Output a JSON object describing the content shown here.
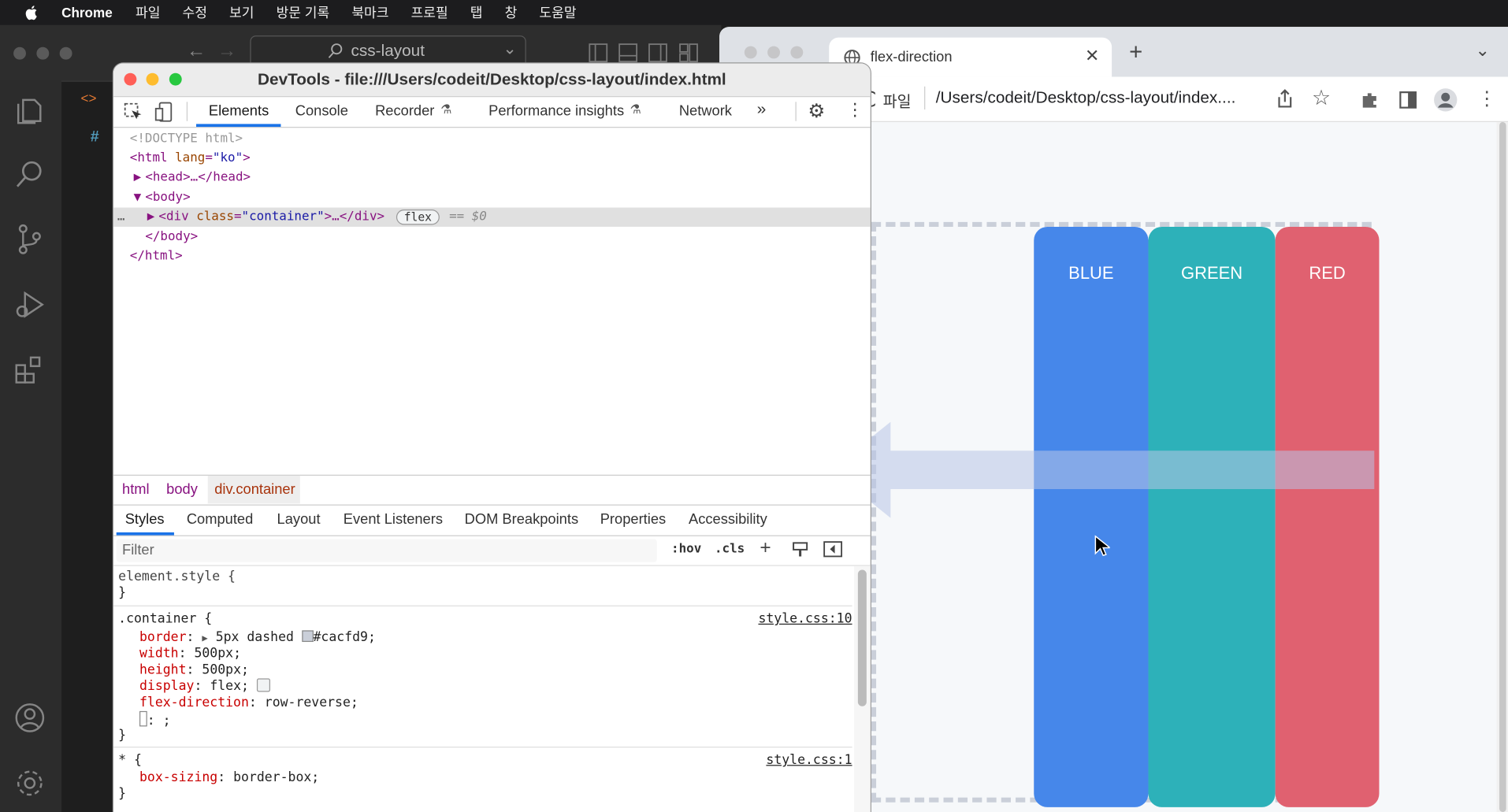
{
  "menubar": {
    "app": "Chrome",
    "items": [
      "파일",
      "수정",
      "보기",
      "방문 기록",
      "북마크",
      "프로필",
      "탭",
      "창",
      "도움말"
    ]
  },
  "vscode": {
    "search": "css-layout",
    "tab_hint": "<>",
    "editor_hash": "#"
  },
  "chrome": {
    "tab_title": "flex-direction",
    "scheme_label": "파일",
    "url": "/Users/codeit/Desktop/css-layout/index....",
    "boxes": [
      {
        "label": "BLUE",
        "color": "#4687ea"
      },
      {
        "label": "GREEN",
        "color": "#2db1b9"
      },
      {
        "label": "RED",
        "color": "#e06170"
      }
    ]
  },
  "devtools": {
    "title": "DevTools - file:///Users/codeit/Desktop/css-layout/index.html",
    "tabs": [
      "Elements",
      "Console",
      "Recorder",
      "Performance insights",
      "Network"
    ],
    "more": "»",
    "dom": {
      "doctype": "<!DOCTYPE html>",
      "html_open": "<html",
      "lang_attr": "lang",
      "lang_val": "\"ko\"",
      "head": "<head>…</head>",
      "body_open": "<body>",
      "div_open": "<div",
      "class_attr": "class",
      "class_val": "\"container\"",
      "div_rest": ">…</div>",
      "flex_badge": "flex",
      "eq": "== $0",
      "body_close": "</body>",
      "html_close": "</html>",
      "ellipsis": "…"
    },
    "breadcrumbs": [
      "html",
      "body",
      "div.container"
    ],
    "subtabs": [
      "Styles",
      "Computed",
      "Layout",
      "Event Listeners",
      "DOM Breakpoints",
      "Properties",
      "Accessibility"
    ],
    "filter_placeholder": "Filter",
    "hov": ":hov",
    "cls": ".cls",
    "plus": "+",
    "rules": {
      "element_style": "element.style {",
      "container_sel": ".container {",
      "container_src": "style.css:10",
      "border_prop": "border",
      "border_val": "5px dashed",
      "border_color": "#cacfd9;",
      "width_prop": "width",
      "width_val": "500px;",
      "height_prop": "height",
      "height_val": "500px;",
      "display_prop": "display",
      "display_val": "flex;",
      "fd_prop": "flex-direction",
      "fd_val": "row-reverse;",
      "empty_line": ": ;",
      "star_sel": "* {",
      "star_src": "style.css:1",
      "bs_prop": "box-sizing",
      "bs_val": "border-box;",
      "close": "}"
    }
  }
}
